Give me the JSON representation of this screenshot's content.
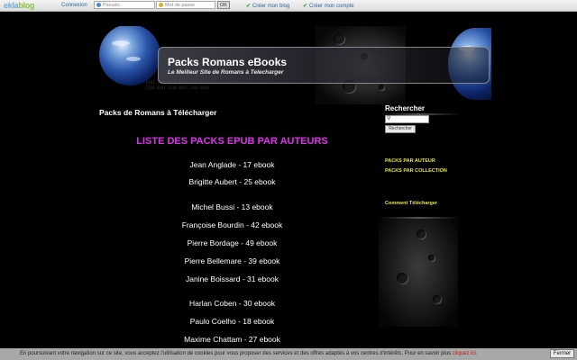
{
  "topbar": {
    "logo_a": "ekla",
    "logo_b": "blog",
    "login_label": "Connexion",
    "username_placeholder": "Pseudo",
    "password_placeholder": "Mot de passe",
    "ok_label": "OK",
    "create_blog": "Créer mon blog",
    "create_account": "Créer mon compte"
  },
  "header": {
    "title": "Packs Romans eBooks",
    "subtitle": "Le Meilleur Site de Romans à Telecharger"
  },
  "main": {
    "page_title": "Packs de Romans à Télécharger",
    "list_title": "LISTE DES PACKS EPUB PAR AUTEURS",
    "authors": [
      "Jean Anglade - 17 ebook",
      "Brigitte Aubert - 25 ebook",
      "Michel Bussi - 13 ebook",
      "Françoise Bourdin - 42 ebook",
      "Pierre Bordage - 49 ebook",
      "Pierre Bellemare - 39 ebook",
      "Janine Boissard - 31 ebook",
      "Harlan Coben - 30 ebook",
      "Paulo Coelho - 18 ebook",
      "Maxime Chattam - 27 ebook"
    ]
  },
  "sidebar": {
    "search_title": "Rechercher",
    "search_button": "Rechercher",
    "links": [
      "PACKS PAR AUTEUR",
      "PACKS PAR COLLECTION",
      "Comment Télécharger"
    ]
  },
  "cookie": {
    "text": "En poursuivant votre navigation sur ce site, vous acceptez l'utilisation de cookies pour vous proposer des services et des offres adaptés à vos centres d'intérêts. Pour en savoir plus",
    "more": "cliquez ici.",
    "close": "Fermer"
  },
  "colors": {
    "background": "#000000",
    "list_title": "#e22ef0",
    "sidebar_links": "#e8e640"
  }
}
